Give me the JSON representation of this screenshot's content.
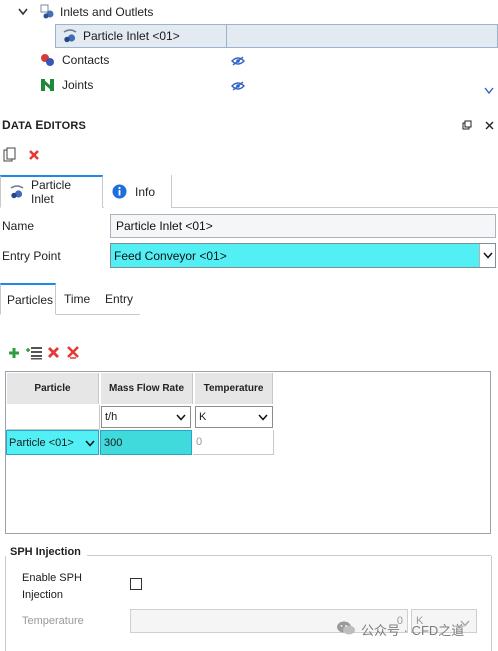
{
  "tree": {
    "items": [
      {
        "label": "Inlets and Outlets",
        "icon": "inlet-outlet-group-icon"
      },
      {
        "label": "Particle Inlet <01>",
        "icon": "particle-inlet-icon",
        "selected": true
      },
      {
        "label": "Contacts",
        "icon": "contacts-icon",
        "visibility_icon": "hidden-eye-icon"
      },
      {
        "label": "Joints",
        "icon": "joints-icon",
        "visibility_icon": "hidden-eye-icon"
      }
    ]
  },
  "data_editors": {
    "title_first": "D",
    "title_rest": "ATA ",
    "title_second": "E",
    "title_second_rest": "DITORS",
    "toolbar": {
      "copy_icon": "copy-icon",
      "delete_icon": "delete-icon"
    },
    "tabs": [
      {
        "label": "Particle Inlet",
        "icon": "particle-inlet-icon",
        "active": true
      },
      {
        "label": "Info",
        "icon": "info-icon",
        "active": false
      }
    ],
    "fields": {
      "name_label": "Name",
      "name_value": "Particle Inlet <01>",
      "entry_point_label": "Entry Point",
      "entry_point_value": "Feed Conveyor <01>"
    },
    "sub_tabs": [
      {
        "label": "Particles",
        "active": true
      },
      {
        "label": "Time",
        "active": false
      },
      {
        "label": "Entry",
        "active": false
      }
    ],
    "grid_toolbar": [
      "add-icon",
      "add-row-list-icon",
      "delete-icon",
      "delete-all-icon"
    ],
    "table": {
      "headers": [
        "Particle",
        "Mass Flow Rate",
        "Temperature"
      ],
      "units": {
        "mass_flow_rate": "t/h",
        "temperature": "K"
      },
      "rows": [
        {
          "particle": "Particle <01>",
          "mass_flow_rate": "300",
          "temperature": "0"
        }
      ]
    },
    "sph": {
      "heading": "SPH Injection",
      "enable_label_line1": "Enable SPH",
      "enable_label_line2": "Injection",
      "enabled": false,
      "temperature_label": "Temperature",
      "temperature_value": "0",
      "temperature_unit": "K"
    }
  },
  "watermark": {
    "text": "公众号 · CFD之道"
  },
  "colors": {
    "accent": "#1e88e5",
    "cyan_selection": "#52f0f5",
    "cell_selection": "#40d9dc",
    "delete_red": "#e53935",
    "add_green": "#2e9e3e"
  }
}
